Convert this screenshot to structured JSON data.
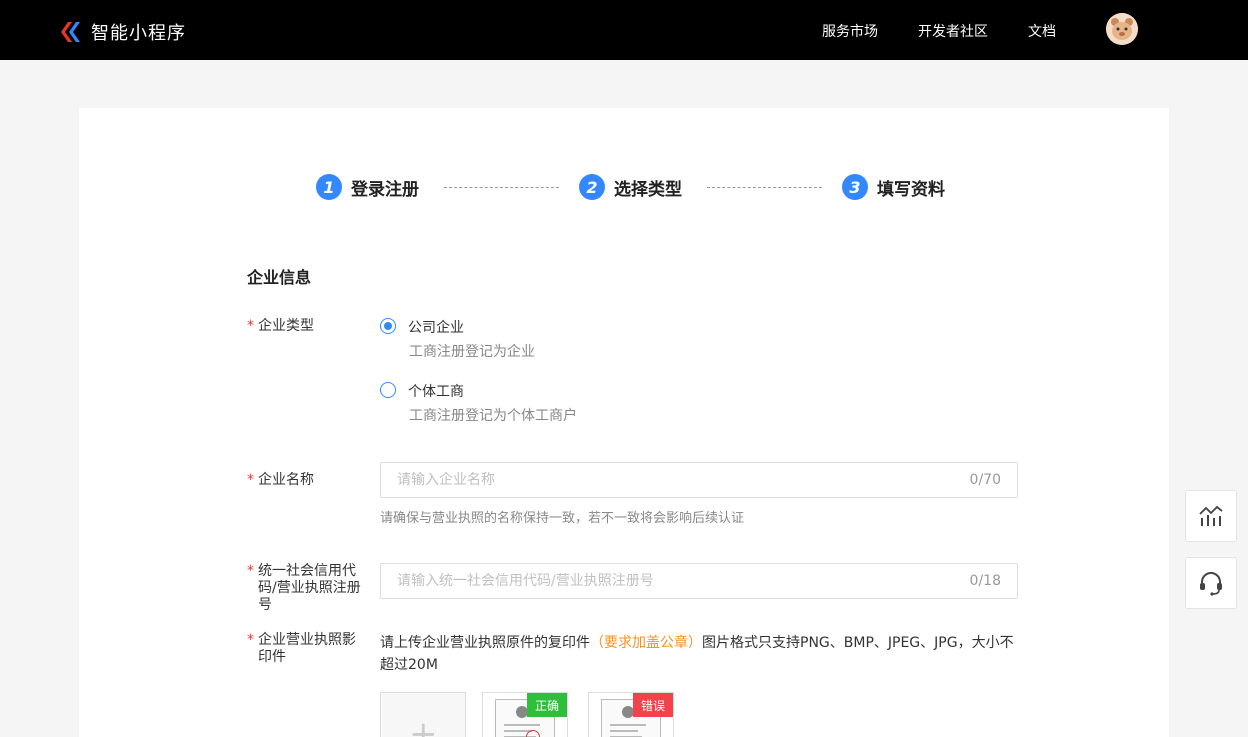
{
  "header": {
    "logo_text": "智能小程序",
    "nav": [
      "服务市场",
      "开发者社区",
      "文档"
    ]
  },
  "steps": [
    {
      "num": "1",
      "label": "登录注册"
    },
    {
      "num": "2",
      "label": "选择类型"
    },
    {
      "num": "3",
      "label": "填写资料"
    }
  ],
  "form": {
    "section_title": "企业信息",
    "required_mark": "*",
    "enterprise_type": {
      "label": "企业类型",
      "options": [
        {
          "label": "公司企业",
          "desc": "工商注册登记为企业",
          "checked": true
        },
        {
          "label": "个体工商",
          "desc": "工商注册登记为个体工商户",
          "checked": false
        }
      ]
    },
    "company_name": {
      "label": "企业名称",
      "placeholder": "请输入企业名称",
      "counter": "0/70",
      "hint": "请确保与营业执照的名称保持一致，若不一致将会影响后续认证"
    },
    "credit_code": {
      "label": "统一社会信用代码/营业执照注册号",
      "placeholder": "请输入统一社会信用代码/营业执照注册号",
      "counter": "0/18"
    },
    "license": {
      "label": "企业营业执照影印件",
      "desc_prefix": "请上传企业营业执照原件的复印件",
      "desc_highlight": "（要求加盖公章）",
      "desc_suffix": "图片格式只支持PNG、BMP、JPEG、JPG，大小不超过20M",
      "upload_plus": "+",
      "sample_correct": "正确",
      "sample_wrong": "错误"
    }
  },
  "colors": {
    "primary": "#3388ff",
    "required": "#e53935",
    "highlight": "#f7931e",
    "correct": "#2fbf3a",
    "wrong": "#f0434b"
  },
  "icons": {
    "float1": "chart-icon",
    "float2": "headset-icon"
  }
}
